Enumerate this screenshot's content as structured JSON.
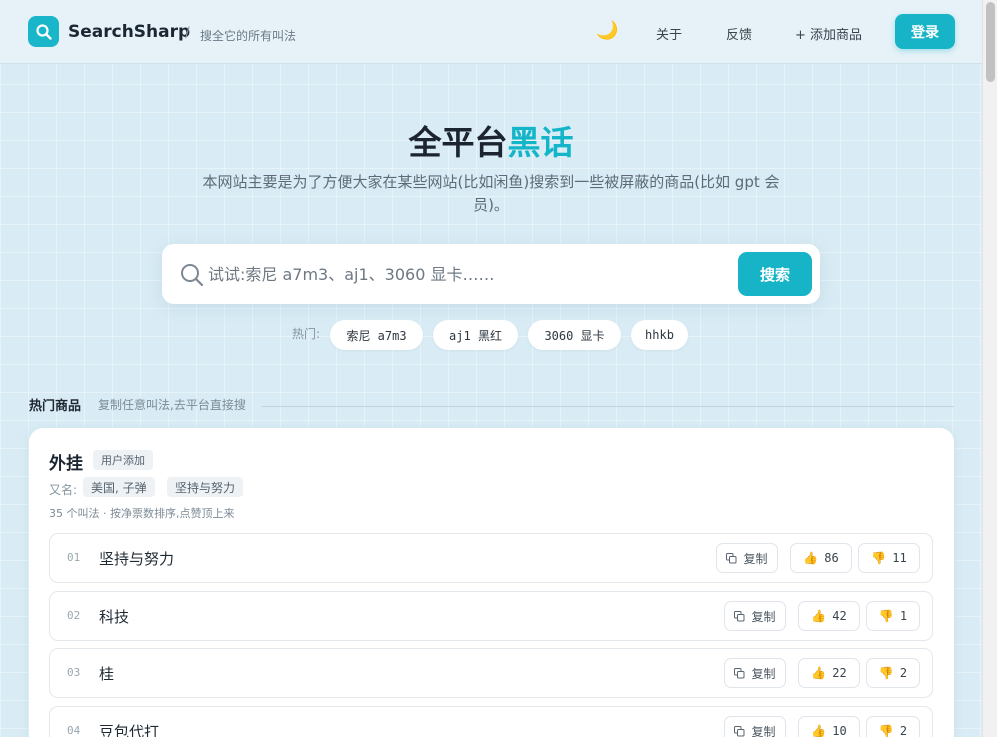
{
  "header": {
    "brand": "SearchSharp",
    "separator": "/",
    "tagline": "搜全它的所有叫法",
    "nav": {
      "about": "关于",
      "feedback": "反馈",
      "add": "+ 添加商品"
    },
    "login": "登录"
  },
  "hero": {
    "title_main": "全平台",
    "title_accent": "黑话",
    "description": "本网站主要是为了方便大家在某些网站(比如闲鱼)搜索到一些被屏蔽的商品(比如 gpt 会员)。",
    "search": {
      "placeholder": "试试:索尼 a7m3、aj1、3060 显卡……",
      "button": "搜索"
    },
    "hot_label": "热门:",
    "hot_tags": [
      "索尼 a7m3",
      "aj1 黑红",
      "3060 显卡",
      "hhkb"
    ]
  },
  "section": {
    "title": "热门商品",
    "subtitle": "复制任意叫法,去平台直接搜"
  },
  "card": {
    "title": "外挂",
    "badge": "用户添加",
    "alias_label": "又名:",
    "aliases": [
      "美国, 子弹",
      "坚持与努力"
    ],
    "meta": "35 个叫法 · 按净票数排序,点赞顶上来",
    "copy_label": "复制",
    "rows": [
      {
        "num": "01",
        "text": "坚持与努力",
        "up": "86",
        "down": "11"
      },
      {
        "num": "02",
        "text": "科技",
        "up": "42",
        "down": "1"
      },
      {
        "num": "03",
        "text": "桂",
        "up": "22",
        "down": "2"
      },
      {
        "num": "04",
        "text": "豆包代打",
        "up": "10",
        "down": "2"
      }
    ]
  },
  "colors": {
    "accent": "#17b4c7",
    "background": "#d9ecf5"
  }
}
